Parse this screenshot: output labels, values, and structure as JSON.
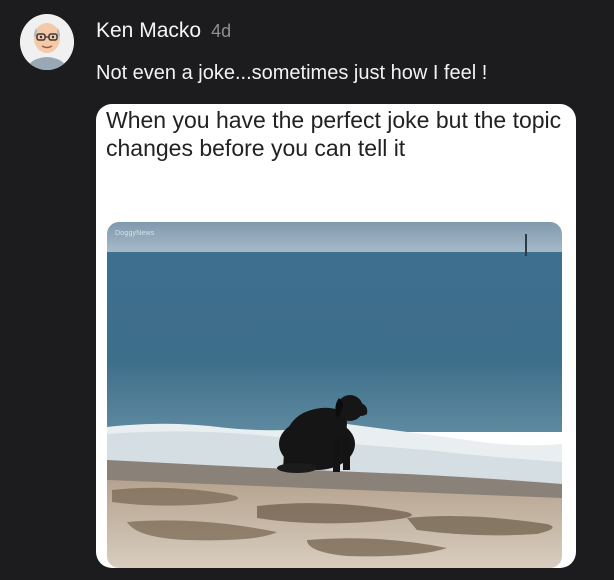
{
  "post": {
    "author_name": "Ken Macko",
    "timestamp": "4d",
    "message": "Not even a joke...sometimes just how I feel !",
    "avatar_icon": "bitmoji-avatar-icon"
  },
  "attachment": {
    "caption": "When you have the perfect joke but the topic changes before you can tell it",
    "watermark": "DoggyNews",
    "photo_subject": "dog-on-beach-image"
  },
  "colors": {
    "background": "#1c1c1e",
    "text_primary": "#f5f5f5",
    "text_secondary": "#8e8e93",
    "card_background": "#ffffff"
  }
}
